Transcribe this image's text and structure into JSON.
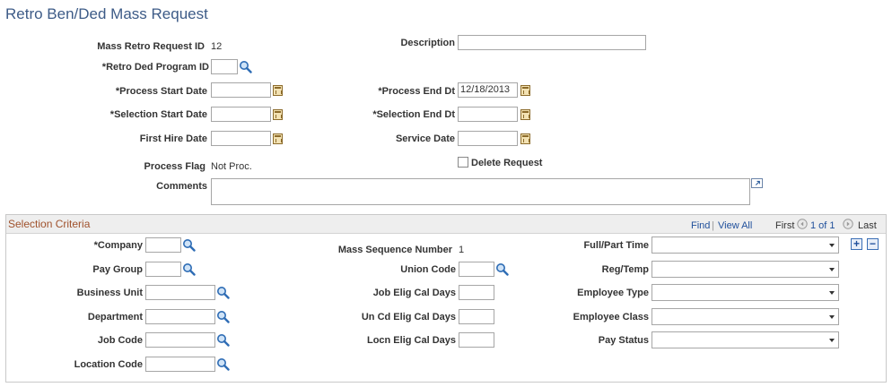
{
  "page": {
    "title": "Retro Ben/Ded Mass Request"
  },
  "header": {
    "mass_retro_request_id_label": "Mass Retro Request ID",
    "mass_retro_request_id_value": "12",
    "description_label": "Description",
    "description_value": "",
    "retro_ded_program_id_label": "*Retro Ded Program ID",
    "retro_ded_program_id_value": "",
    "process_start_date_label": "*Process Start Date",
    "process_start_date_value": "",
    "process_end_dt_label": "*Process End Dt",
    "process_end_dt_value": "12/18/2013",
    "selection_start_date_label": "*Selection Start Date",
    "selection_start_date_value": "",
    "selection_end_dt_label": "*Selection End Dt",
    "selection_end_dt_value": "",
    "first_hire_date_label": "First Hire Date",
    "first_hire_date_value": "",
    "service_date_label": "Service Date",
    "service_date_value": "",
    "process_flag_label": "Process Flag",
    "process_flag_value": "Not Proc.",
    "delete_request_label": "Delete Request",
    "delete_request_checked": false,
    "comments_label": "Comments",
    "comments_value": ""
  },
  "selection": {
    "title": "Selection Criteria",
    "find": "Find",
    "separator": "|",
    "view_all": "View All",
    "first": "First",
    "counter": "1 of 1",
    "last": "Last",
    "company_label": "*Company",
    "pay_group_label": "Pay Group",
    "business_unit_label": "Business Unit",
    "department_label": "Department",
    "job_code_label": "Job Code",
    "location_code_label": "Location Code",
    "mass_sequence_number_label": "Mass Sequence Number",
    "mass_sequence_number_value": "1",
    "union_code_label": "Union Code",
    "job_elig_cal_days_label": "Job Elig Cal Days",
    "un_cd_elig_cal_days_label": "Un Cd Elig Cal Days",
    "locn_elig_cal_days_label": "Locn Elig Cal Days",
    "full_part_time_label": "Full/Part Time",
    "reg_temp_label": "Reg/Temp",
    "employee_type_label": "Employee Type",
    "employee_class_label": "Employee Class",
    "pay_status_label": "Pay Status",
    "add_row": "+",
    "delete_row": "−"
  },
  "icons": {
    "lookup": "magnifier-icon",
    "calendar": "calendar-icon",
    "expand": "expand-icon"
  },
  "colors": {
    "title": "#3d5b87",
    "panel_title": "#a0522d",
    "link": "#1f4f9b"
  }
}
